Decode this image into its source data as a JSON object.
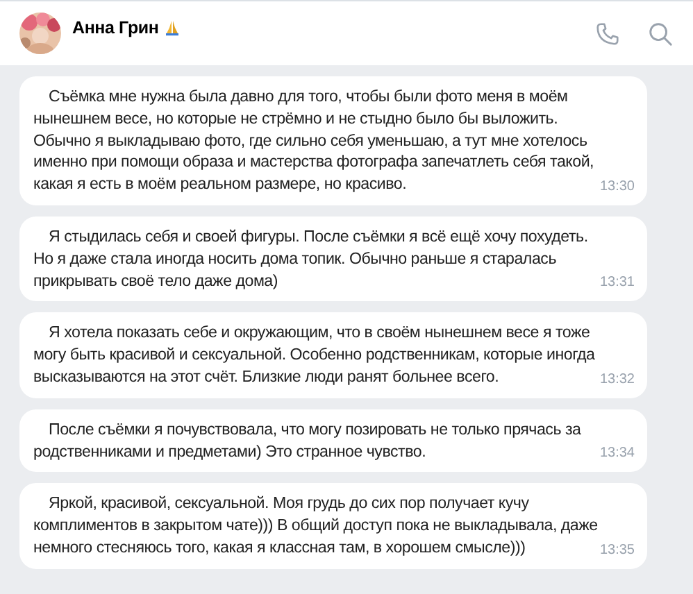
{
  "header": {
    "name": "Анна Грин"
  },
  "messages": [
    {
      "lines": [
        "Съёмка мне нужна была давно для того, чтобы были фото меня в моём",
        "нынешнем весе, но которые не стрёмно и не стыдно было бы выложить.",
        "Обычно я выкладываю фото, где сильно себя уменьшаю, а тут мне хотелось",
        "именно при помощи образа и мастерства фотографа запечатлеть себя такой,",
        "какая я есть в моём реальном размере, но красиво."
      ],
      "time": "13:30"
    },
    {
      "lines": [
        "Я стыдилась себя и своей фигуры. После съёмки я всё ещё хочу похудеть.",
        "Но я даже стала иногда носить дома топик. Обычно раньше я старалась",
        "прикрывать своё тело даже дома)"
      ],
      "time": "13:31"
    },
    {
      "lines": [
        "Я хотела показать себе и окружающим, что в своём нынешнем весе я тоже",
        "могу быть красивой и сексуальной. Особенно родственникам, которые иногда",
        "высказываются на этот счёт. Близкие люди ранят больнее всего."
      ],
      "time": "13:32"
    },
    {
      "lines": [
        "После съёмки я почувствовала, что могу позировать не только прячась за",
        "родственниками и предметами) Это странное чувство."
      ],
      "time": "13:34"
    },
    {
      "lines": [
        "Яркой, красивой, сексуальной. Моя грудь до сих пор получает кучу",
        "комплиментов в закрытом чате))) В общий доступ пока не выкладывала, даже",
        "немного стесняюсь того, какая я классная там, в хорошем смысле)))"
      ],
      "time": "13:35"
    }
  ]
}
